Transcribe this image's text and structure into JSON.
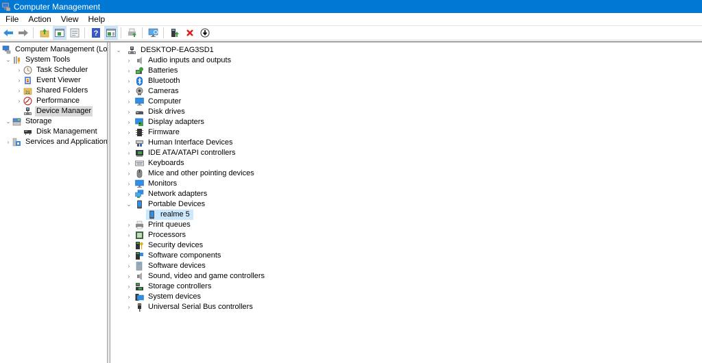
{
  "window": {
    "title": "Computer Management"
  },
  "menu": [
    "File",
    "Action",
    "View",
    "Help"
  ],
  "toolbar": {
    "buttons": [
      {
        "name": "back-button",
        "icon": "arrow-left-icon"
      },
      {
        "name": "forward-button",
        "icon": "arrow-right-icon"
      },
      {
        "name": "up-one-level-button",
        "icon": "folder-up-icon"
      },
      {
        "name": "show-hide-console-tree-button",
        "icon": "console-tree-icon",
        "active": true
      },
      {
        "name": "properties-button",
        "icon": "properties-icon"
      },
      {
        "name": "help-button",
        "icon": "help-icon"
      },
      {
        "name": "show-hide-action-pane-button",
        "icon": "action-pane-icon",
        "active": true
      },
      {
        "name": "print-button",
        "icon": "printer-icon"
      },
      {
        "name": "scan-hardware-button",
        "icon": "monitor-scan-icon"
      },
      {
        "name": "update-driver-button",
        "icon": "update-driver-icon"
      },
      {
        "name": "uninstall-device-button",
        "icon": "red-x-icon"
      },
      {
        "name": "disable-device-button",
        "icon": "download-circle-icon"
      }
    ]
  },
  "left_tree": {
    "root": "Computer Management (Local)",
    "items": [
      {
        "label": "System Tools",
        "level": 1,
        "expanded": true,
        "icon": "tools-icon"
      },
      {
        "label": "Task Scheduler",
        "level": 2,
        "expandable": true,
        "icon": "clock-icon"
      },
      {
        "label": "Event Viewer",
        "level": 2,
        "expandable": true,
        "icon": "event-viewer-icon"
      },
      {
        "label": "Shared Folders",
        "level": 2,
        "expandable": true,
        "icon": "shared-folder-icon"
      },
      {
        "label": "Performance",
        "level": 2,
        "expandable": true,
        "icon": "performance-icon"
      },
      {
        "label": "Device Manager",
        "level": 2,
        "expandable": false,
        "selected": true,
        "icon": "device-manager-icon"
      },
      {
        "label": "Storage",
        "level": 1,
        "expanded": true,
        "icon": "storage-icon"
      },
      {
        "label": "Disk Management",
        "level": 2,
        "expandable": false,
        "icon": "disk-icon"
      },
      {
        "label": "Services and Applications",
        "level": 1,
        "expandable": true,
        "icon": "services-icon"
      }
    ]
  },
  "device_tree": {
    "root": "DESKTOP-EAG3SD1",
    "categories": [
      {
        "label": "Audio inputs and outputs",
        "icon": "speaker-icon"
      },
      {
        "label": "Batteries",
        "icon": "battery-icon"
      },
      {
        "label": "Bluetooth",
        "icon": "bluetooth-icon"
      },
      {
        "label": "Cameras",
        "icon": "camera-icon"
      },
      {
        "label": "Computer",
        "icon": "computer-icon"
      },
      {
        "label": "Disk drives",
        "icon": "disk-drive-icon"
      },
      {
        "label": "Display adapters",
        "icon": "display-adapter-icon"
      },
      {
        "label": "Firmware",
        "icon": "firmware-icon"
      },
      {
        "label": "Human Interface Devices",
        "icon": "hid-icon"
      },
      {
        "label": "IDE ATA/ATAPI controllers",
        "icon": "ide-controller-icon"
      },
      {
        "label": "Keyboards",
        "icon": "keyboard-icon"
      },
      {
        "label": "Mice and other pointing devices",
        "icon": "mouse-icon"
      },
      {
        "label": "Monitors",
        "icon": "monitor-icon"
      },
      {
        "label": "Network adapters",
        "icon": "network-icon"
      },
      {
        "label": "Portable Devices",
        "icon": "portable-device-icon",
        "expanded": true,
        "children": [
          {
            "label": "realme 5",
            "icon": "phone-icon",
            "selected": true
          }
        ]
      },
      {
        "label": "Print queues",
        "icon": "printer-icon"
      },
      {
        "label": "Processors",
        "icon": "processor-icon"
      },
      {
        "label": "Security devices",
        "icon": "security-icon"
      },
      {
        "label": "Software components",
        "icon": "software-component-icon"
      },
      {
        "label": "Software devices",
        "icon": "software-device-icon"
      },
      {
        "label": "Sound, video and game controllers",
        "icon": "sound-icon"
      },
      {
        "label": "Storage controllers",
        "icon": "storage-controller-icon"
      },
      {
        "label": "System devices",
        "icon": "system-devices-icon"
      },
      {
        "label": "Universal Serial Bus controllers",
        "icon": "usb-icon"
      }
    ]
  },
  "colors": {
    "titlebar": "#0078d4",
    "selection": "#cce8ff",
    "selection_inactive": "#d9d9d9"
  }
}
